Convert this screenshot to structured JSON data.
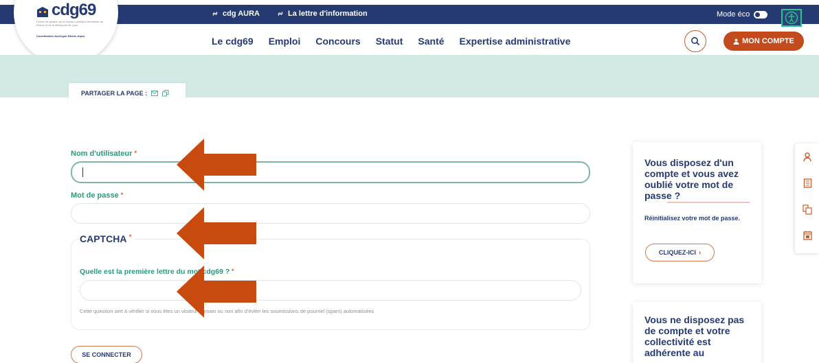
{
  "topbar": {
    "link1_label": "cdg AURA",
    "link2_label": "La lettre d'information",
    "eco_label": "Mode éco"
  },
  "logo": {
    "word": "cdg69",
    "subtitle": "Centre de gestion de la fonction publique territoriale du Rhône et de la Métropole de Lyon",
    "coordinator": "Coordinateur Auvergne-Rhône-Alpes"
  },
  "nav": {
    "items": [
      "Le cdg69",
      "Emploi",
      "Concours",
      "Statut",
      "Santé",
      "Expertise administrative"
    ],
    "account_label": "MON COMPTE"
  },
  "share": {
    "label": "PARTAGER LA PAGE :"
  },
  "form": {
    "username_label": "Nom d'utilisateur",
    "password_label": "Mot de passe",
    "required_mark": "*",
    "username_value": "",
    "password_value": "",
    "captcha_title": "CAPTCHA",
    "captcha_question": "Quelle est la première lettre du mot cdg69 ?",
    "captcha_value": "",
    "captcha_help": "Cette question sert à vérifier si vous êtes un visiteur humain ou non afin d'éviter les soumissions de pourriel (spam) automatisées",
    "submit_label": "SE CONNECTER"
  },
  "cards": {
    "forgot_title": "Vous disposez d'un compte et vous avez oublié votre mot de passe ?",
    "forgot_text": "Réinitialisez votre mot de passe.",
    "forgot_button": "CLIQUEZ-ICI",
    "nocount_title": "Vous ne disposez pas de compte et votre collectivité est adhérente au"
  },
  "dock": {
    "icons": [
      "user-icon",
      "book-icon",
      "documents-icon",
      "calendar-icon"
    ]
  },
  "colors": {
    "navy": "#253a70",
    "accent": "#c24a1c",
    "teal": "#2a9a7c",
    "banner": "#d3e9e5"
  }
}
